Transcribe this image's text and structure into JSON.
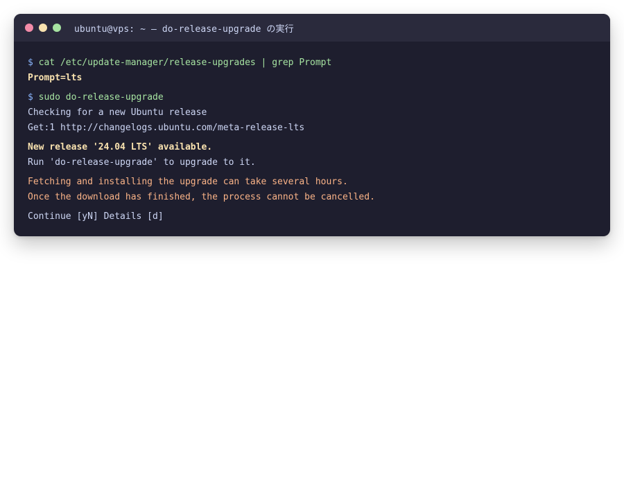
{
  "window": {
    "title": "ubuntu@vps: ~ — do-release-upgrade の実行",
    "controls": [
      {
        "name": "close",
        "color": "#f38ba8"
      },
      {
        "name": "minimize",
        "color": "#f9e2af"
      },
      {
        "name": "maximize",
        "color": "#a6e3a1"
      }
    ]
  },
  "terminal": {
    "prompt_symbol": "$",
    "blocks": [
      {
        "command": "cat /etc/update-manager/release-upgrades | grep Prompt",
        "output": [
          {
            "text": "Prompt=lts",
            "style": "highlight"
          }
        ]
      },
      {
        "command": "sudo do-release-upgrade",
        "output": [
          {
            "text": "Checking for a new Ubuntu release",
            "style": "plain"
          },
          {
            "text": "Get:1 http://changelogs.ubuntu.com/meta-release-lts",
            "style": "plain"
          }
        ]
      }
    ],
    "release_notice": [
      {
        "text": "New release '24.04 LTS' available.",
        "style": "highlight"
      },
      {
        "text": "Run 'do-release-upgrade' to upgrade to it.",
        "style": "plain"
      }
    ],
    "warnings": [
      {
        "text": "Fetching and installing the upgrade can take several hours.",
        "style": "warning"
      },
      {
        "text": "Once the download has finished, the process cannot be cancelled.",
        "style": "warning"
      }
    ],
    "continue_prompt": "Continue [yN] Details [d]"
  },
  "colors": {
    "background": "#1e1e2e",
    "titlebar": "#2a2a3c",
    "prompt": "#89b4fa",
    "command": "#a6e3a1",
    "highlight": "#f9e2af",
    "warning": "#fab387",
    "text": "#cdd6f4"
  }
}
